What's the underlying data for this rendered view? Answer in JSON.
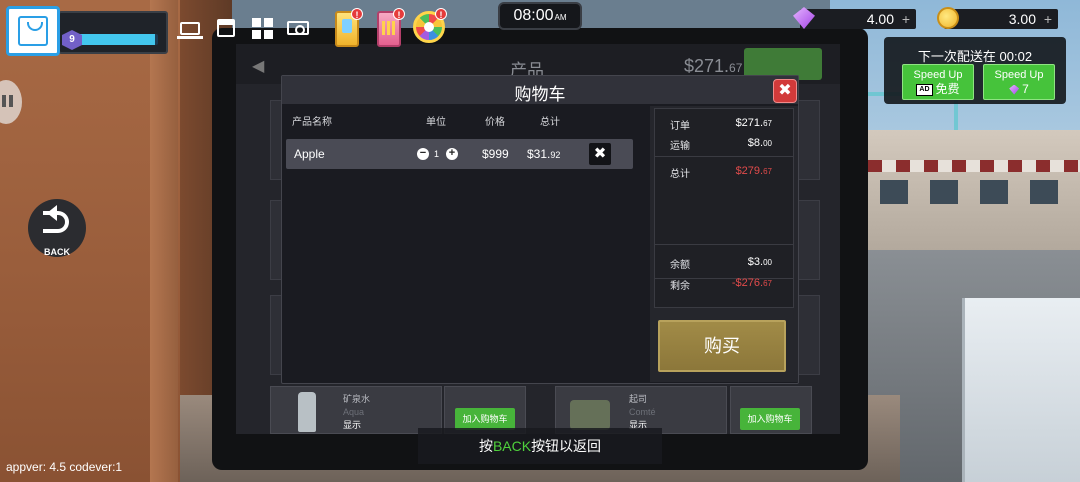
{
  "hud": {
    "level": "9",
    "xp_fraction": 0.97,
    "clock_time": "08:00",
    "clock_ampm": "AM",
    "gems": "4.00",
    "coins": "3.00",
    "plus_label": "+",
    "alert_label": "!"
  },
  "delivery": {
    "title": "下一次配送在 00:02",
    "speed_label": "Speed Up",
    "ad_badge": "AD",
    "free_label": "免费",
    "gem_cost": "7"
  },
  "shop_bg": {
    "title": "产品",
    "price_whole": "$271.",
    "price_cents": "67",
    "item_left_name": "矿泉水",
    "item_left_sub": "Aqua",
    "item_right_name": "起司",
    "item_right_sub": "Comté",
    "show_label": "显示",
    "add_to_cart_label": "加入购物车"
  },
  "cart": {
    "title": "购物车",
    "close_label": "✖",
    "columns": {
      "name": "产品名称",
      "unit": "单位",
      "price": "价格",
      "total": "总计"
    },
    "items": [
      {
        "name": "Apple",
        "qty": "1",
        "price": "$999",
        "total_whole": "$31.",
        "total_cents": "92"
      }
    ],
    "minus_label": "−",
    "plus_label": "+",
    "remove_label": "✖",
    "summary": {
      "order_label": "订单",
      "order_whole": "$271.",
      "order_cents": "67",
      "shipping_label": "运输",
      "shipping_whole": "$8.",
      "shipping_cents": "00",
      "total_label": "总计",
      "total_whole": "$279.",
      "total_cents": "67",
      "balance_label": "余额",
      "balance_whole": "$3.",
      "balance_cents": "00",
      "remaining_label": "剩余",
      "remaining_whole": "-$276.",
      "remaining_cents": "67"
    },
    "buy_label": "购买"
  },
  "back_button": {
    "label": "BACK"
  },
  "back_hint": {
    "pre": "按",
    "key": "BACK",
    "post": "按钮以返回"
  },
  "version_text": "appver: 4.5 codever:1",
  "colors": {
    "accent_green": "#46c33b",
    "warning_red": "#e14b4b",
    "buy_gold": "#a18b47",
    "xp_cyan": "#43c7ee"
  }
}
